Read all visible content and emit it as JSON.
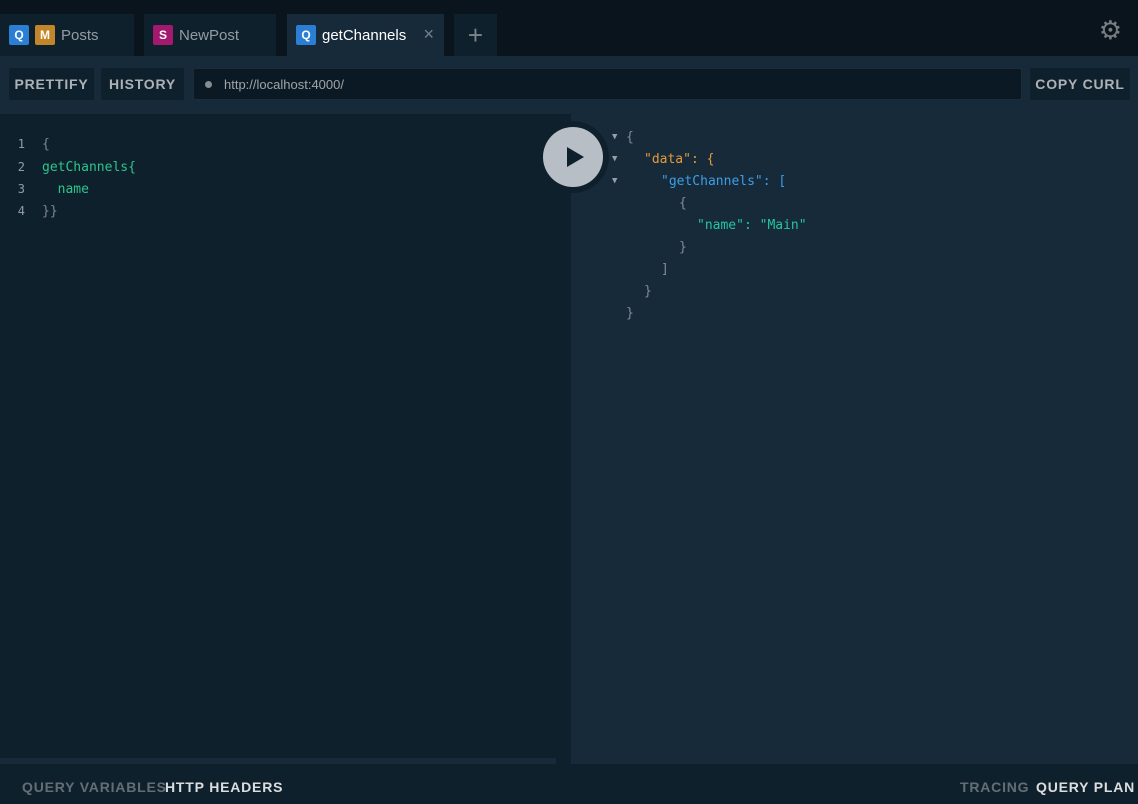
{
  "tabs": [
    {
      "badges": [
        "Q",
        "M"
      ],
      "label": "Posts",
      "active": false
    },
    {
      "badges": [
        "S"
      ],
      "label": "NewPost",
      "active": false
    },
    {
      "badges": [
        "Q"
      ],
      "label": "getChannels",
      "active": true,
      "close": "×"
    }
  ],
  "add_tab": "+",
  "settings_icon": "⚙",
  "toolbar": {
    "prettify": "PRETTIFY",
    "history": "HISTORY",
    "endpoint_url": "http://localhost:4000/",
    "copy_curl": "COPY CURL"
  },
  "editor": {
    "lines": [
      {
        "num": "1",
        "text": "{"
      },
      {
        "num": "2",
        "text": "getChannels{"
      },
      {
        "num": "3",
        "text": "  name"
      },
      {
        "num": "4",
        "text": "}}"
      }
    ]
  },
  "result": {
    "lines": [
      "{",
      "\"data\": {",
      "\"getChannels\": [",
      "{",
      "\"name\": \"Main\"",
      "}",
      "]",
      "}",
      "}"
    ]
  },
  "bottom": {
    "query_variables": "QUERY VARIABLES",
    "http_headers": "HTTP HEADERS",
    "tracing": "TRACING",
    "query_plan": "QUERY PLAN"
  },
  "colors": {
    "background": "#0f202d",
    "panel": "#172a3a",
    "field_green": "#2bc58b",
    "key_orange": "#e59a3c",
    "key_blue": "#3d9ee4",
    "badge_query": "#2a7ed3",
    "badge_mutation": "#c2852a",
    "badge_subscription": "#a3196e"
  }
}
